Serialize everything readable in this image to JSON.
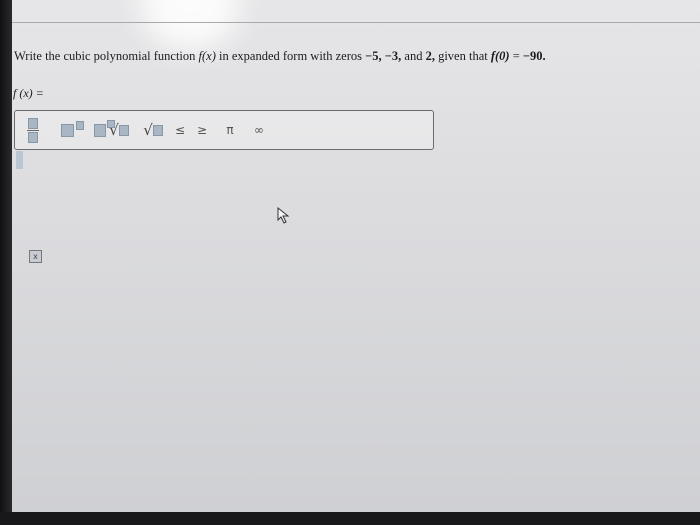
{
  "question": {
    "intro": "Write the cubic polynomial function ",
    "func": "f(x)",
    "middle": " in expanded form with zeros ",
    "zeros": "−5, −3,",
    "and": " and ",
    "last_zero": "2,",
    "given": " given that ",
    "condition": "f(0)",
    "equals": " = ",
    "value": "−90."
  },
  "answer": {
    "label": "f (x) ="
  },
  "toolbar": {
    "sqrt_symbol": "√",
    "less_equal": "≤",
    "greater_equal": "≥",
    "pi": "π",
    "infinity": "∞"
  },
  "small_button": {
    "label": "x"
  },
  "colors": {
    "placeholder_box": "#a9b6c4",
    "text": "#1c1c1e"
  }
}
